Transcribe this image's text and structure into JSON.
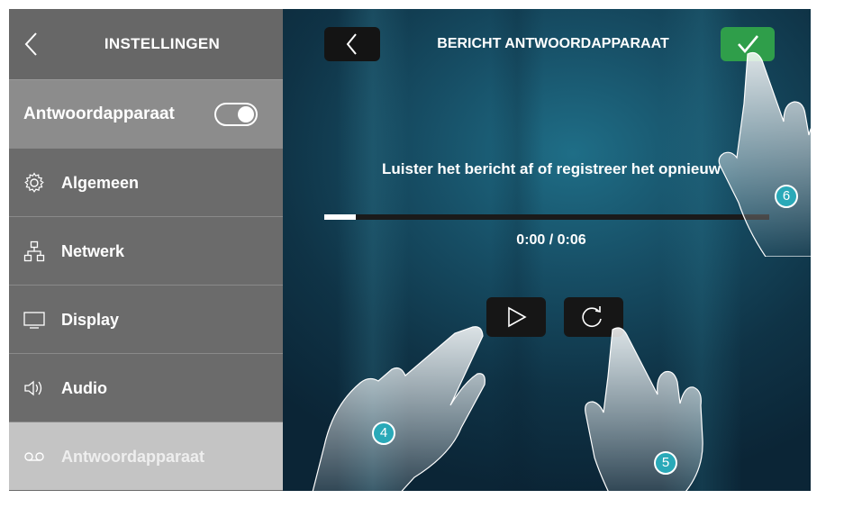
{
  "sidebar": {
    "title": "INSTELLINGEN",
    "toggle_label": "Antwoordapparaat",
    "toggle_on": true,
    "items": [
      {
        "label": "Algemeen",
        "icon": "gear-icon"
      },
      {
        "label": "Netwerk",
        "icon": "network-icon"
      },
      {
        "label": "Display",
        "icon": "monitor-icon"
      },
      {
        "label": "Audio",
        "icon": "speaker-icon"
      },
      {
        "label": "Antwoordapparaat",
        "icon": "voicemail-icon",
        "active": true
      }
    ]
  },
  "main": {
    "title": "BERICHT ANTWOORDAPPARAAT",
    "message": "Luister het bericht af of registreer het opnieuw",
    "time": "0:00 / 0:06",
    "progress": 0.07,
    "play_icon": "play-icon",
    "rerecord_icon": "rerecord-icon",
    "confirm_icon": "checkmark-icon",
    "back_icon": "chevron-left-icon"
  },
  "callouts": [
    "4",
    "5",
    "6"
  ],
  "colors": {
    "confirm": "#2f9e4a",
    "callout": "#2aa9b8",
    "sidebar": "#6b6b6b",
    "active_item": "#c4c4c4"
  }
}
